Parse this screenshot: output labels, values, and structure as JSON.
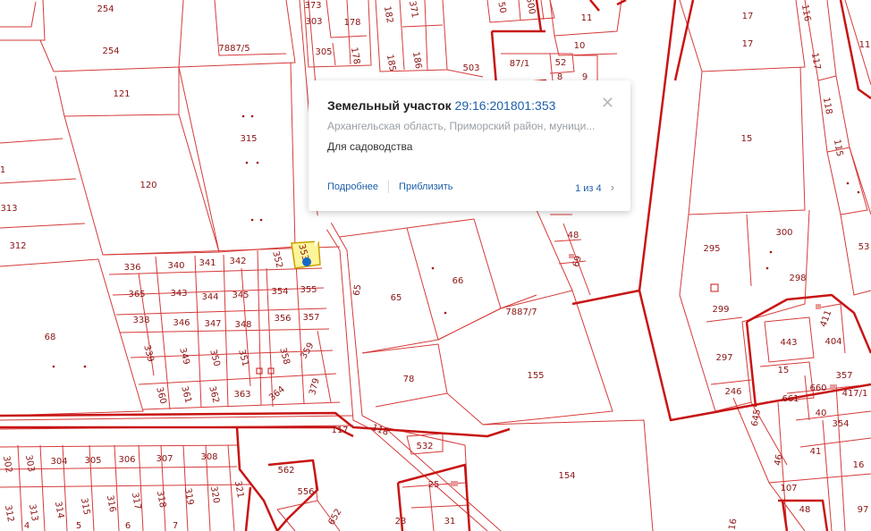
{
  "popup": {
    "title_label": "Земельный участок",
    "cadastral_number": "29:16:201801:353",
    "address": "Архангельская область, Приморский район, муници...",
    "purpose": "Для садоводства",
    "more_label": "Подробнее",
    "zoom_label": "Приблизить",
    "pager_text": "1 из 4",
    "close_glyph": "✕",
    "next_glyph": "›"
  },
  "colors": {
    "parcel_border": "#d63a3a",
    "quarter_border": "#c81414",
    "label": "#8a1212",
    "selected_fill": "#fdf59a",
    "marker": "#1769c9",
    "link": "#1d5fa8"
  },
  "parcels": [
    {
      "id": "p254a",
      "label": "254"
    },
    {
      "id": "p254b",
      "label": "254"
    },
    {
      "id": "p7887_5",
      "label": "7887/5"
    },
    {
      "id": "p121",
      "label": "121"
    },
    {
      "id": "p315",
      "label": "315"
    },
    {
      "id": "p120",
      "label": "120"
    },
    {
      "id": "p313",
      "label": "313"
    },
    {
      "id": "p312",
      "label": "312"
    },
    {
      "id": "p1",
      "label": "1"
    },
    {
      "id": "p68",
      "label": "68"
    },
    {
      "id": "p336",
      "label": "336"
    },
    {
      "id": "p340",
      "label": "340"
    },
    {
      "id": "p341",
      "label": "341"
    },
    {
      "id": "p342",
      "label": "342"
    },
    {
      "id": "p352",
      "label": "352"
    },
    {
      "id": "p353",
      "label": "353"
    },
    {
      "id": "p365",
      "label": "365"
    },
    {
      "id": "p343",
      "label": "343"
    },
    {
      "id": "p344",
      "label": "344"
    },
    {
      "id": "p345",
      "label": "345"
    },
    {
      "id": "p354",
      "label": "354"
    },
    {
      "id": "p355",
      "label": "355"
    },
    {
      "id": "p338",
      "label": "338"
    },
    {
      "id": "p346",
      "label": "346"
    },
    {
      "id": "p347",
      "label": "347"
    },
    {
      "id": "p348",
      "label": "348"
    },
    {
      "id": "p356",
      "label": "356"
    },
    {
      "id": "p357",
      "label": "357"
    },
    {
      "id": "p339",
      "label": "339"
    },
    {
      "id": "p349",
      "label": "349"
    },
    {
      "id": "p350",
      "label": "350"
    },
    {
      "id": "p351",
      "label": "351"
    },
    {
      "id": "p358",
      "label": "358"
    },
    {
      "id": "p359",
      "label": "359"
    },
    {
      "id": "p360",
      "label": "360"
    },
    {
      "id": "p361",
      "label": "361"
    },
    {
      "id": "p362",
      "label": "362"
    },
    {
      "id": "p363",
      "label": "363"
    },
    {
      "id": "p364",
      "label": "364"
    },
    {
      "id": "p379",
      "label": "379"
    },
    {
      "id": "p117",
      "label": "117"
    },
    {
      "id": "p118",
      "label": "118"
    },
    {
      "id": "p303",
      "label": "303"
    },
    {
      "id": "p373",
      "label": "373"
    },
    {
      "id": "p305",
      "label": "305"
    },
    {
      "id": "p178a",
      "label": "178"
    },
    {
      "id": "p178b",
      "label": "178"
    },
    {
      "id": "p182",
      "label": "182"
    },
    {
      "id": "p185",
      "label": "185"
    },
    {
      "id": "p186",
      "label": "186"
    },
    {
      "id": "p371",
      "label": "371"
    },
    {
      "id": "p503",
      "label": "503"
    },
    {
      "id": "p500",
      "label": "500"
    },
    {
      "id": "p50",
      "label": "50"
    },
    {
      "id": "p11",
      "label": "11"
    },
    {
      "id": "p10",
      "label": "10"
    },
    {
      "id": "p87_1",
      "label": "87/1"
    },
    {
      "id": "p52",
      "label": "52"
    },
    {
      "id": "p8",
      "label": "8"
    },
    {
      "id": "p9",
      "label": "9"
    },
    {
      "id": "p48",
      "label": "48"
    },
    {
      "id": "p69",
      "label": "69"
    },
    {
      "id": "p65a",
      "label": "65"
    },
    {
      "id": "p65b",
      "label": "65"
    },
    {
      "id": "p66",
      "label": "66"
    },
    {
      "id": "p7887_7",
      "label": "7887/7"
    },
    {
      "id": "p78",
      "label": "78"
    },
    {
      "id": "p155",
      "label": "155"
    },
    {
      "id": "p154",
      "label": "154"
    },
    {
      "id": "p532",
      "label": "532"
    },
    {
      "id": "p562",
      "label": "562"
    },
    {
      "id": "p556",
      "label": "556"
    },
    {
      "id": "p652",
      "label": "652"
    },
    {
      "id": "p25",
      "label": "25"
    },
    {
      "id": "p23",
      "label": "23"
    },
    {
      "id": "p31",
      "label": "31"
    },
    {
      "id": "p17a",
      "label": "17"
    },
    {
      "id": "p17b",
      "label": "17"
    },
    {
      "id": "p116",
      "label": "116"
    },
    {
      "id": "p117r",
      "label": "117"
    },
    {
      "id": "p118r",
      "label": "118"
    },
    {
      "id": "p115",
      "label": "115"
    },
    {
      "id": "p11r",
      "label": "11"
    },
    {
      "id": "p15",
      "label": "15"
    },
    {
      "id": "p295",
      "label": "295"
    },
    {
      "id": "p300",
      "label": "300"
    },
    {
      "id": "p298",
      "label": "298"
    },
    {
      "id": "p299",
      "label": "299"
    },
    {
      "id": "p297",
      "label": "297"
    },
    {
      "id": "p246",
      "label": "246"
    },
    {
      "id": "p411",
      "label": "411"
    },
    {
      "id": "p443",
      "label": "443"
    },
    {
      "id": "p404",
      "label": "404"
    },
    {
      "id": "p15b",
      "label": "15"
    },
    {
      "id": "p357r",
      "label": "357"
    },
    {
      "id": "p661",
      "label": "661"
    },
    {
      "id": "p660",
      "label": "660"
    },
    {
      "id": "p417_1",
      "label": "417/1"
    },
    {
      "id": "p40",
      "label": "40"
    },
    {
      "id": "p354r",
      "label": "354"
    },
    {
      "id": "p41",
      "label": "41"
    },
    {
      "id": "p645",
      "label": "645"
    },
    {
      "id": "p46",
      "label": "46"
    },
    {
      "id": "p107",
      "label": "107"
    },
    {
      "id": "p48r",
      "label": "48"
    },
    {
      "id": "p302",
      "label": "302"
    },
    {
      "id": "p303b",
      "label": "303"
    },
    {
      "id": "p304",
      "label": "304"
    },
    {
      "id": "p305b",
      "label": "305"
    },
    {
      "id": "p306",
      "label": "306"
    },
    {
      "id": "p307",
      "label": "307"
    },
    {
      "id": "p308",
      "label": "308"
    },
    {
      "id": "p312b",
      "label": "312"
    },
    {
      "id": "p313b",
      "label": "313"
    },
    {
      "id": "p314",
      "label": "314"
    },
    {
      "id": "p315b",
      "label": "315"
    },
    {
      "id": "p316",
      "label": "316"
    },
    {
      "id": "p317",
      "label": "317"
    },
    {
      "id": "p318",
      "label": "318"
    },
    {
      "id": "p319",
      "label": "319"
    },
    {
      "id": "p320",
      "label": "320"
    },
    {
      "id": "p321",
      "label": "321"
    },
    {
      "id": "p4",
      "label": "4"
    },
    {
      "id": "p5",
      "label": "5"
    },
    {
      "id": "p6",
      "label": "6"
    },
    {
      "id": "p7",
      "label": "7"
    },
    {
      "id": "p16a",
      "label": "16"
    },
    {
      "id": "p16b",
      "label": "16"
    },
    {
      "id": "p53",
      "label": "53"
    },
    {
      "id": "p97",
      "label": "97"
    }
  ]
}
